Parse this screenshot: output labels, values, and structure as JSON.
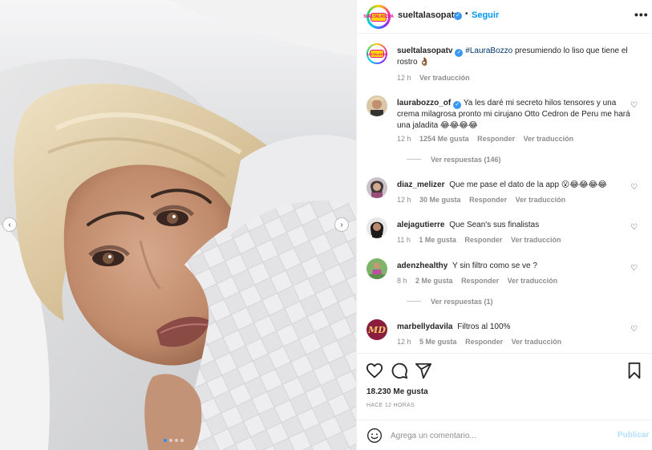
{
  "post": {
    "image_alt": "",
    "carousel": {
      "slide_count": 4,
      "active_index": 0
    }
  },
  "header": {
    "avatar_logo_text": "SUELTALASOPA",
    "username": "sueltalasopatv",
    "separator": "•",
    "follow_label": "Seguir",
    "more_label": "•••"
  },
  "caption": {
    "username": "sueltalasopatv",
    "hashtag": "#LauraBozzo",
    "text": "presumiendo lo liso que tiene el rostro 👌🏾",
    "time": "12 h",
    "translate_label": "Ver traducción"
  },
  "comments": [
    {
      "username": "laurabozzo_of",
      "verified": true,
      "text": "Ya les daré mi secreto hilos tensores y una crema milagrosa pronto mi cirujano Otto Cedron de Peru me hará una jaladita 😂😂😂😂",
      "time": "12 h",
      "likes": "1254 Me gusta",
      "reply_label": "Responder",
      "translate_label": "Ver traducción",
      "view_replies": "Ver respuestas (146)"
    },
    {
      "username": "diaz_melizer",
      "text": "Que me pase el dato de la app 😮😂😂😂😂",
      "time": "12 h",
      "likes": "30 Me gusta",
      "reply_label": "Responder",
      "translate_label": "Ver traducción"
    },
    {
      "username": "alejagutierre",
      "text": "Que Sean's sus finalistas",
      "time": "11 h",
      "likes": "1 Me gusta",
      "reply_label": "Responder",
      "translate_label": "Ver traducción"
    },
    {
      "username": "adenzhealthy",
      "text": "Y sin filtro como se ve ?",
      "time": "8 h",
      "likes": "2 Me gusta",
      "reply_label": "Responder",
      "translate_label": "Ver traducción",
      "view_replies": "Ver respuestas (1)"
    },
    {
      "username": "marbellydavila",
      "avatar_text": "MD",
      "text": "Filtros al 100%",
      "time": "12 h",
      "likes": "5 Me gusta",
      "reply_label": "Responder",
      "translate_label": "Ver traducción"
    }
  ],
  "actions": {
    "like_icon": "heart-icon",
    "comment_icon": "comment-icon",
    "share_icon": "share-icon",
    "save_icon": "bookmark-icon",
    "likes_count": "18.230 Me gusta",
    "posted_time": "HACE 12 HORAS"
  },
  "composer": {
    "placeholder": "Agrega un comentario...",
    "publish_label": "Publicar"
  },
  "colors": {
    "link_blue": "#0095f6",
    "verified_blue": "#3897f0",
    "publish_disabled": "#b2dffc",
    "muted_text": "#8e8e8e"
  }
}
